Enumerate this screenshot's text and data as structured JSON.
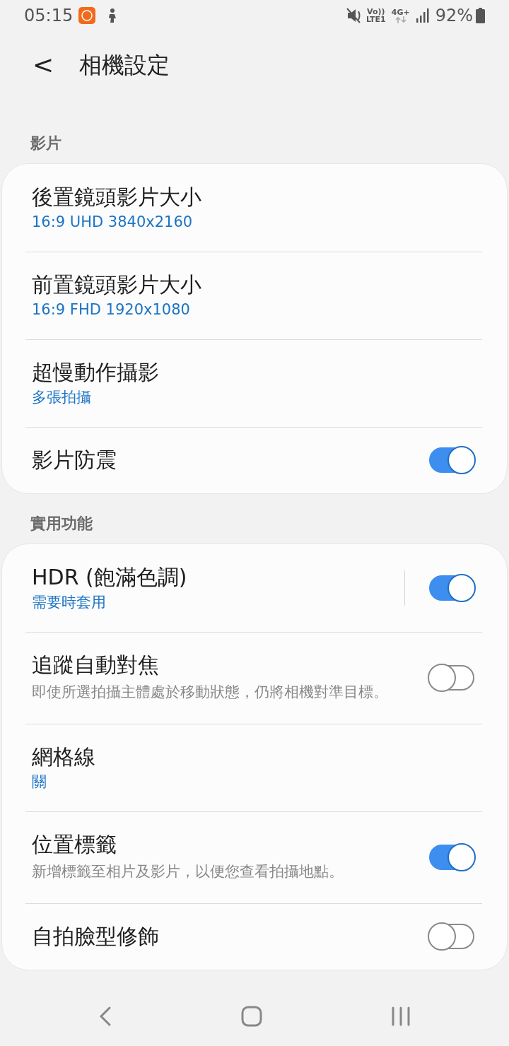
{
  "status_bar": {
    "time": "05:15",
    "network": [
      "Vo))",
      "LTE1",
      "4G+"
    ],
    "battery_text": "92%"
  },
  "header": {
    "back": "<",
    "title": "相機設定"
  },
  "sections": [
    {
      "label": "影片",
      "rows": [
        {
          "title": "後置鏡頭影片大小",
          "value": "16:9 UHD 3840x2160"
        },
        {
          "title": "前置鏡頭影片大小",
          "value": "16:9 FHD 1920x1080"
        },
        {
          "title": "超慢動作攝影",
          "value": "多張拍攝"
        },
        {
          "title": "影片防震",
          "toggle": {
            "on": true
          }
        }
      ]
    },
    {
      "label": "實用功能",
      "rows": [
        {
          "title": "HDR (飽滿色調)",
          "value": "需要時套用",
          "toggle": {
            "on": true,
            "separated": true
          }
        },
        {
          "title": "追蹤自動對焦",
          "description": "即使所選拍攝主體處於移動狀態，仍將相機對準目標。",
          "toggle": {
            "on": false
          }
        },
        {
          "title": "網格線",
          "value": "關"
        },
        {
          "title": "位置標籤",
          "description": "新增標籤至相片及影片，以便您查看拍攝地點。",
          "toggle": {
            "on": true
          }
        },
        {
          "title": "自拍臉型修飾",
          "toggle": {
            "on": false
          }
        }
      ]
    }
  ]
}
